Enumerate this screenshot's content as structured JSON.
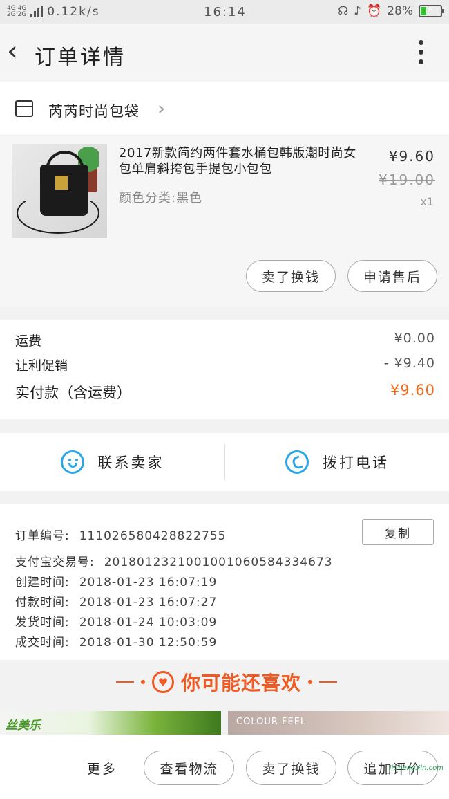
{
  "status_bar": {
    "net_top": "4G 4G",
    "net_bottom": "2G 2G",
    "speed": "0.12k/s",
    "time": "16:14",
    "battery": "28%",
    "battery_level": 0.28
  },
  "header": {
    "title": "订单详情"
  },
  "shop": {
    "name": "芮芮时尚包袋"
  },
  "product": {
    "title": "2017新款简约两件套水桶包韩版潮时尚女包单肩斜挎包手提包小包包",
    "sku": "颜色分类:黑色",
    "price": "¥9.60",
    "original_price": "¥19.00",
    "quantity": "x1",
    "refund_label": "卖了换钱",
    "aftersale_label": "申请售后"
  },
  "fees": {
    "shipping_label": "运费",
    "shipping_value": "¥0.00",
    "promo_label": "让利促销",
    "promo_value": "- ¥9.40",
    "paid_label": "实付款（含运费）",
    "paid_value": "¥9.60"
  },
  "contact": {
    "seller_label": "联系卖家",
    "phone_label": "拨打电话"
  },
  "order_info": {
    "order_no_label": "订单编号:",
    "order_no": "111026580428822755",
    "alipay_label": "支付宝交易号:",
    "alipay_no": "2018012321001001060584334673",
    "created_label": "创建时间:",
    "created": "2018-01-23 16:07:19",
    "paid_label": "付款时间:",
    "paid": "2018-01-23 16:07:27",
    "shipped_label": "发货时间:",
    "shipped": "2018-01-24 10:03:09",
    "closed_label": "成交时间:",
    "closed": "2018-01-30 12:50:59",
    "copy_label": "复制"
  },
  "recommend": {
    "title": "你可能还喜欢",
    "item1_brand": "丝美乐",
    "item2_brand": "COLOUR FEEL"
  },
  "bottom": {
    "more_label": "更多",
    "logistics_label": "查看物流",
    "resell_label": "卖了换钱",
    "review_label": "追加评价"
  },
  "watermark": "JiChengXin.com",
  "colors": {
    "accent": "#f06a1a",
    "icon_blue": "#29a6e8"
  }
}
